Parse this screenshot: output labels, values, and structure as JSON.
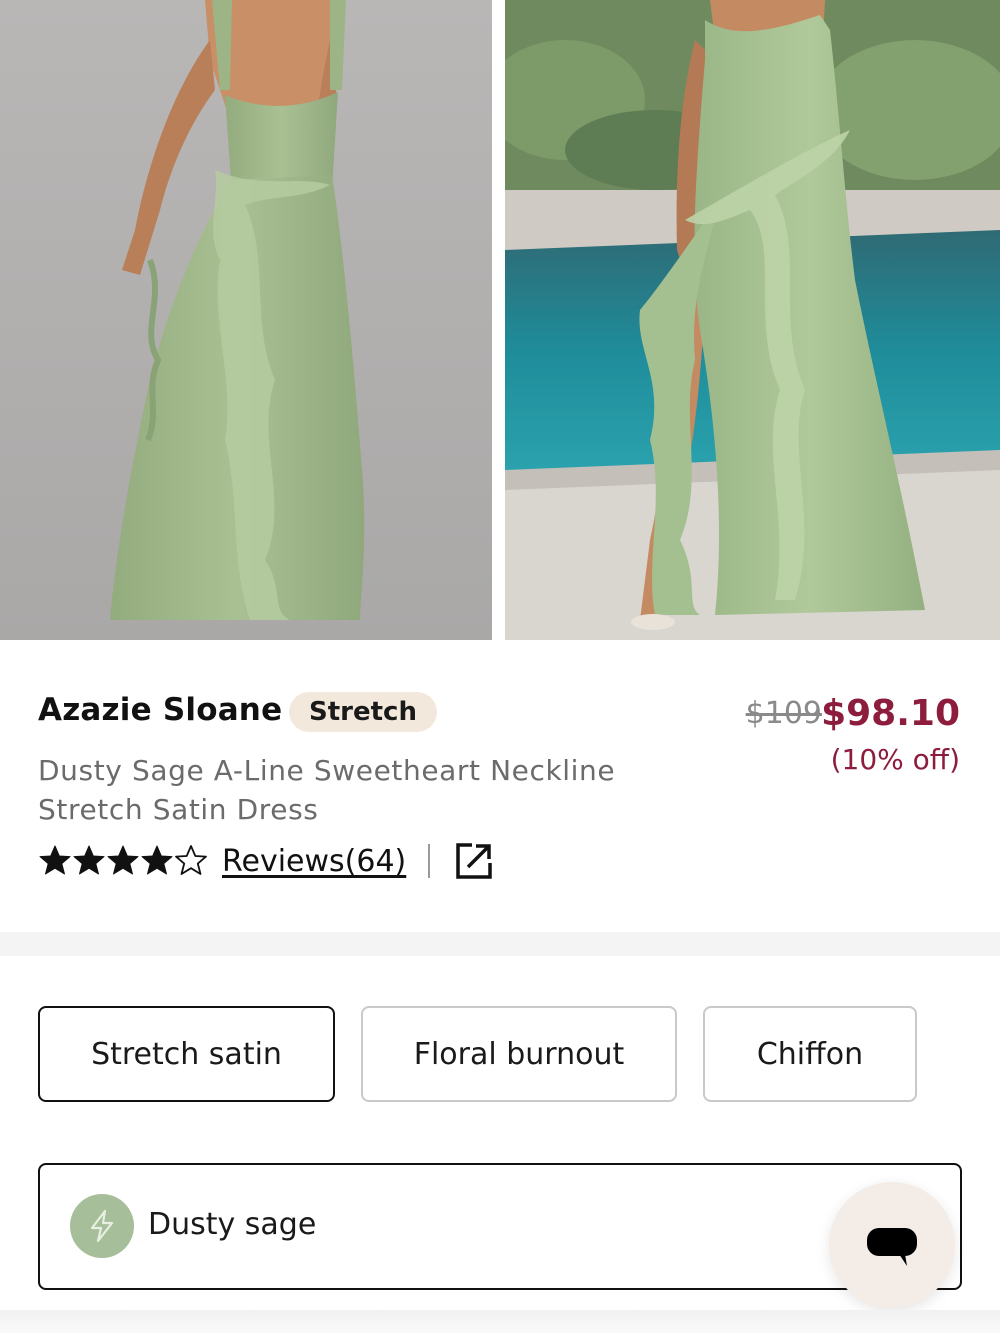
{
  "gallery": {
    "images": [
      {
        "icon": "back-view-dress-photo",
        "color": "#a6bd8e"
      },
      {
        "icon": "front-view-dress-photo-pool",
        "color": "#a9c295"
      }
    ]
  },
  "product": {
    "brand": "Azazie Sloane",
    "badge": "Stretch",
    "subtitle": "Dusty Sage A-Line Sweetheart Neckline Stretch Satin Dress",
    "price_original": "$109",
    "price_sale": "$98.10",
    "discount": "(10% off)",
    "rating": 4,
    "rating_max": 5,
    "reviews_label": "Reviews(64)"
  },
  "fabrics": {
    "options": [
      "Stretch satin",
      "Floral burnout",
      "Chiffon"
    ],
    "selected": "Stretch satin"
  },
  "color": {
    "selected_label": "Dusty sage",
    "swatch_hex": "#a7be9a"
  },
  "colors": {
    "price_accent": "#8c1d3d",
    "badge_bg": "#f3e8dc",
    "chat_bg": "#f4ece6"
  }
}
